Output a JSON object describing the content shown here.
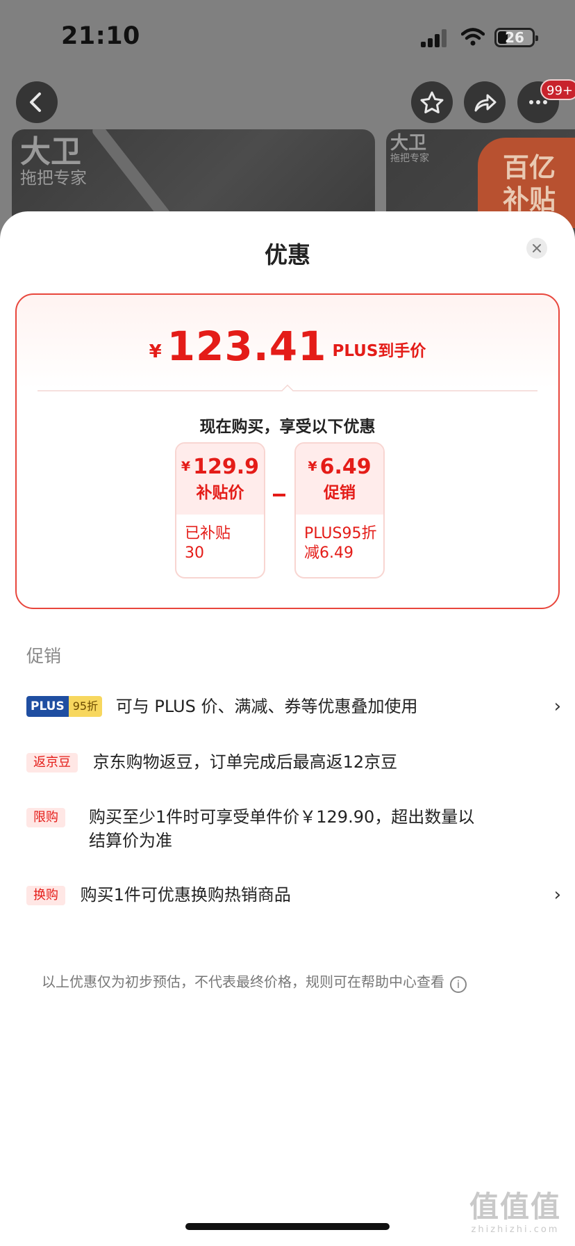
{
  "status_bar": {
    "time": "21:10",
    "battery": "26"
  },
  "nav": {
    "notif_badge": "99+",
    "back_icon": "chevron-left-icon",
    "favorite_icon": "star-icon",
    "share_icon": "share-icon",
    "more_icon": "more-dots-icon"
  },
  "banner": {
    "brand_line1": "大卫",
    "brand_line2": "拖把专家",
    "brand_small_line1": "大卫",
    "brand_small_line2": "拖把专家",
    "subsidy_tag": "百亿\n补贴"
  },
  "sheet": {
    "title": "优惠",
    "close_icon": "close-icon",
    "final": {
      "currency": "¥",
      "amount": "123.41",
      "label": "PLUS到手价"
    },
    "subhead": "现在购买，享受以下优惠",
    "breakdown": [
      {
        "currency": "¥",
        "value": "129.9",
        "name": "补贴价",
        "detail_line1": "已补贴",
        "detail_line2": "30"
      },
      {
        "currency": "¥",
        "value": "6.49",
        "name": "促销",
        "detail_line1": "PLUS95折",
        "detail_line2": "减6.49"
      }
    ],
    "section_label": "促销",
    "promos": [
      {
        "tag_a": "PLUS",
        "tag_b": "95折",
        "text": "可与 PLUS 价、满减、券等优惠叠加使用",
        "has_chevron": true
      },
      {
        "tag": "返京豆",
        "text": "京东购物返豆，订单完成后最高返12京豆",
        "has_chevron": false
      },
      {
        "tag": "限购",
        "text_line1": "购买至少1件时可享受单件价￥129.90，超出数量以",
        "text_line2": "结算价为准",
        "has_chevron": false
      },
      {
        "tag": "换购",
        "text": "购买1件可优惠换购热销商品",
        "has_chevron": true
      }
    ],
    "chevron": "›",
    "footnote": "以上优惠仅为初步预估，不代表最终价格，规则可在帮助中心查看",
    "info_icon": "i"
  },
  "watermark": {
    "main": "值值值",
    "sub": "zhizhizhi.com"
  },
  "colors": {
    "accent": "#e41c18",
    "plus_blue": "#1f4ea1",
    "plus_gold": "#f7d75e"
  }
}
